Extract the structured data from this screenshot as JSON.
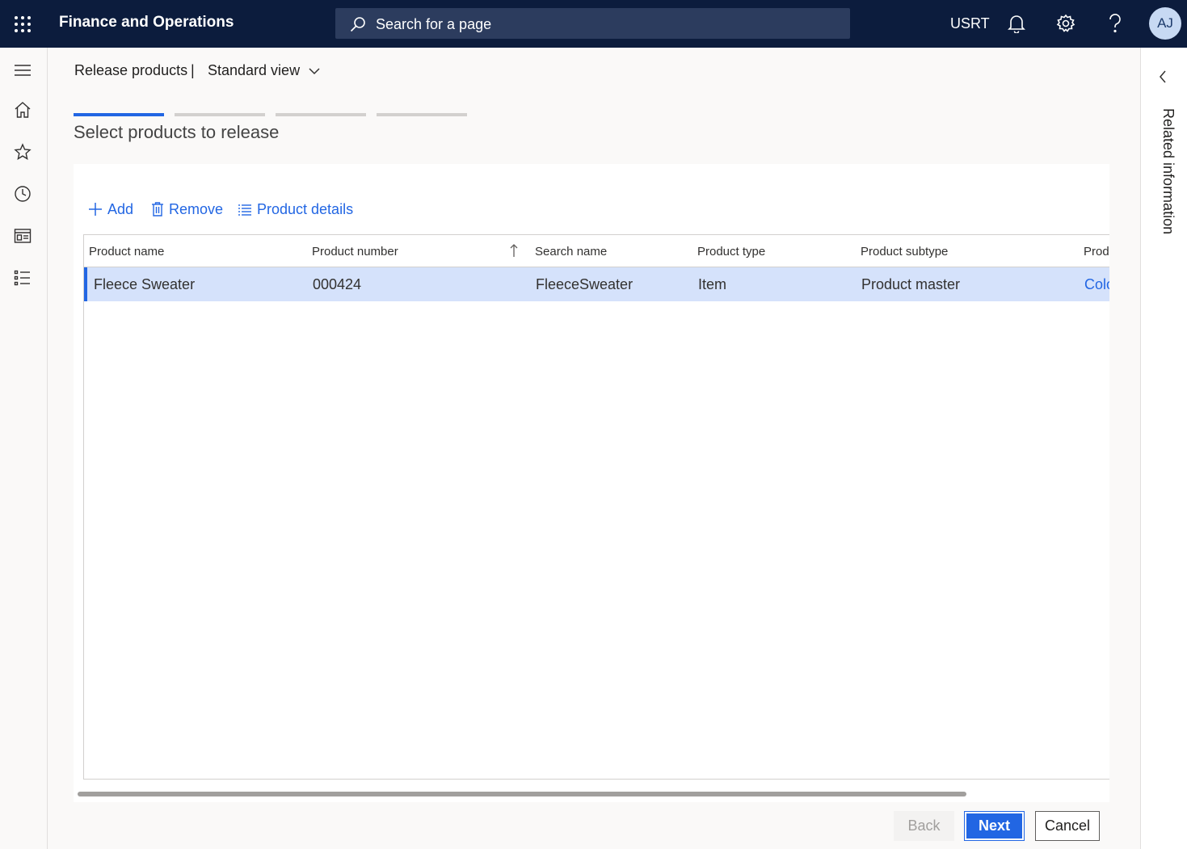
{
  "topbar": {
    "app_title": "Finance and Operations",
    "search_placeholder": "Search for a page",
    "company": "USRT",
    "avatar_initials": "AJ"
  },
  "leftnav": {
    "icons": [
      "hamburger-icon",
      "home-icon",
      "star-icon",
      "clock-icon",
      "workspace-icon",
      "list-icon"
    ]
  },
  "header": {
    "breadcrumb": "Release products",
    "separator": "|",
    "view": "Standard view"
  },
  "wizard": {
    "steps": 4,
    "active_step": 1,
    "title": "Select products to release"
  },
  "actions": {
    "add": "Add",
    "remove": "Remove",
    "details": "Product details"
  },
  "grid": {
    "columns": [
      "Product name",
      "Product number",
      "Search name",
      "Product type",
      "Product subtype",
      "Prod"
    ],
    "sorted_column": "Product number",
    "rows": [
      {
        "product_name": "Fleece Sweater",
        "product_number": "000424",
        "search_name": "FleeceSweater",
        "product_type": "Item",
        "product_subtype": "Product master",
        "dimension": "Colo"
      }
    ]
  },
  "buttons": {
    "back": "Back",
    "next": "Next",
    "cancel": "Cancel"
  },
  "related": {
    "label": "Related information"
  },
  "colors": {
    "topbar": "#0c1c3d",
    "accent": "#2266e3",
    "selected_row": "#d5e2fb"
  }
}
